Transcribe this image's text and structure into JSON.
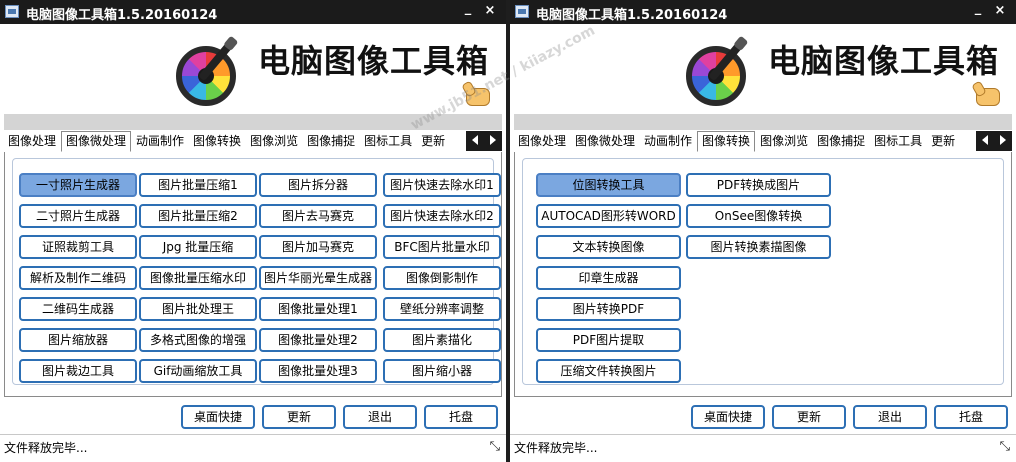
{
  "colors": {
    "titlebar": "#1b1b1b",
    "button_border": "#2d6fb4",
    "button_selected": "#7ba7e0"
  },
  "left": {
    "title": "电脑图像工具箱1.5.20160124",
    "app_name": "电脑图像工具箱",
    "tabs": [
      "图像处理",
      "图像微处理",
      "动画制作",
      "图像转换",
      "图像浏览",
      "图像捕捉",
      "图标工具",
      "更新"
    ],
    "active_tab": "图像微处理",
    "buttons": [
      "一寸照片生成器",
      "图片批量压缩1",
      "图片拆分器",
      "图片快速去除水印1",
      "二寸照片生成器",
      "图片批量压缩2",
      "图片去马赛克",
      "图片快速去除水印2",
      "证照裁剪工具",
      "Jpg 批量压缩",
      "图片加马赛克",
      "BFC图片批量水印",
      "解析及制作二维码",
      "图像批量压缩水印",
      "图片华丽光晕生成器",
      "图像倒影制作",
      "二维码生成器",
      "图片批处理王",
      "图像批量处理1",
      "壁纸分辨率调整",
      "图片缩放器",
      "多格式图像的增强",
      "图像批量处理2",
      "图片素描化",
      "图片裁边工具",
      "Gif动画缩放工具",
      "图像批量处理3",
      "图片缩小器"
    ],
    "bottom": [
      "桌面快捷",
      "更新",
      "退出",
      "托盘"
    ],
    "status": "文件释放完毕..."
  },
  "right": {
    "title": "电脑图像工具箱1.5.20160124",
    "app_name": "电脑图像工具箱",
    "tabs": [
      "图像处理",
      "图像微处理",
      "动画制作",
      "图像转换",
      "图像浏览",
      "图像捕捉",
      "图标工具",
      "更新"
    ],
    "active_tab": "图像转换",
    "col1": [
      "位图转换工具",
      "AUTOCAD图形转WORD",
      "文本转换图像",
      "印章生成器",
      "图片转换PDF",
      "PDF图片提取",
      "压缩文件转换图片"
    ],
    "col2": [
      "PDF转换成图片",
      "OnSee图像转换",
      "图片转换素描图像"
    ],
    "bottom": [
      "桌面快捷",
      "更新",
      "退出",
      "托盘"
    ],
    "status": "文件释放完毕..."
  },
  "watermark": "www.jb51.net / kiiazy.com",
  "icons": {
    "minimize": "minimize-icon",
    "close": "close-icon",
    "resize": "resize-grip-icon",
    "tab_prev": "arrow-left-icon",
    "tab_next": "arrow-right-icon"
  }
}
